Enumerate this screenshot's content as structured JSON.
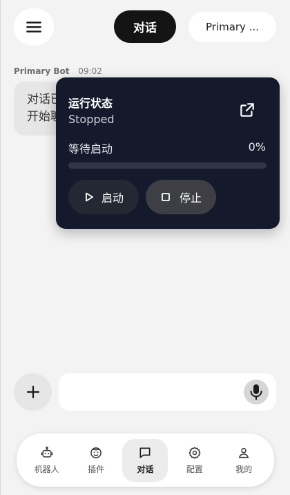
{
  "header": {
    "active_tab": "对话",
    "bot_selector": "Primary ..."
  },
  "message": {
    "sender": "Primary Bot",
    "time": "09:02",
    "text": "对话已开始，可以开始聊天。"
  },
  "status_panel": {
    "title": "运行状态",
    "state": "Stopped",
    "wait_label": "等待启动",
    "progress_percent": 0,
    "progress_text": "0%",
    "start_label": "启动",
    "stop_label": "停止"
  },
  "composer": {
    "value": "",
    "placeholder": ""
  },
  "nav": {
    "robots": "机器人",
    "plugins": "插件",
    "chat": "对话",
    "config": "配置",
    "me": "我的"
  }
}
